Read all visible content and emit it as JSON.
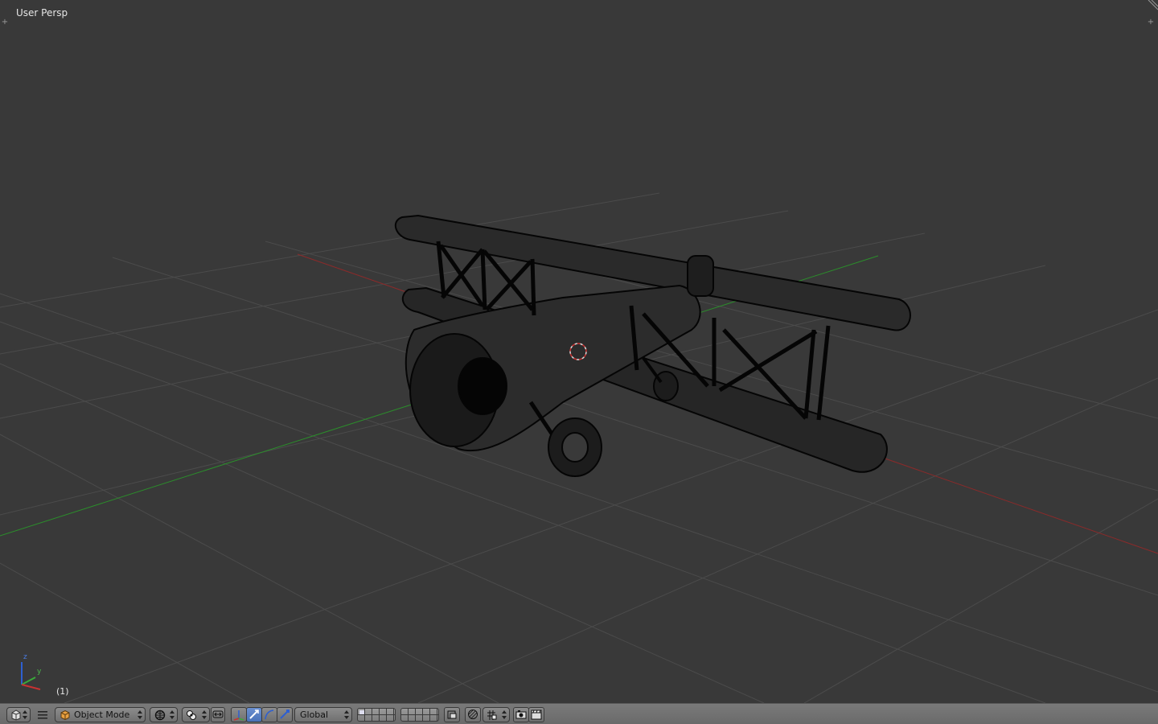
{
  "viewport": {
    "view_label": "User Persp",
    "frame_label": "(1)",
    "axes": {
      "z_label": "z",
      "y_label": "y"
    }
  },
  "header": {
    "mode_select": {
      "value": "Object Mode",
      "icon": "cube-icon"
    },
    "orientation_select": {
      "value": "Global"
    },
    "icons": [
      "editor-type-icon",
      "menu-icon",
      "viewport-shading-icon",
      "pivot-point-icon",
      "manipulator-toggle-icon",
      "translate-icon",
      "rotate-icon",
      "scale-icon",
      "layers-icon",
      "lock-icon",
      "proportional-edit-icon",
      "snap-icon",
      "render-icon",
      "clapboard-icon"
    ]
  },
  "colors": {
    "background": "#393939",
    "grid": "#4a4a4a",
    "x_axis": "#8b2a2a",
    "y_axis": "#2a8b2a",
    "header": "#727272",
    "wireframe": "#000000",
    "cursor": "#c83232"
  }
}
